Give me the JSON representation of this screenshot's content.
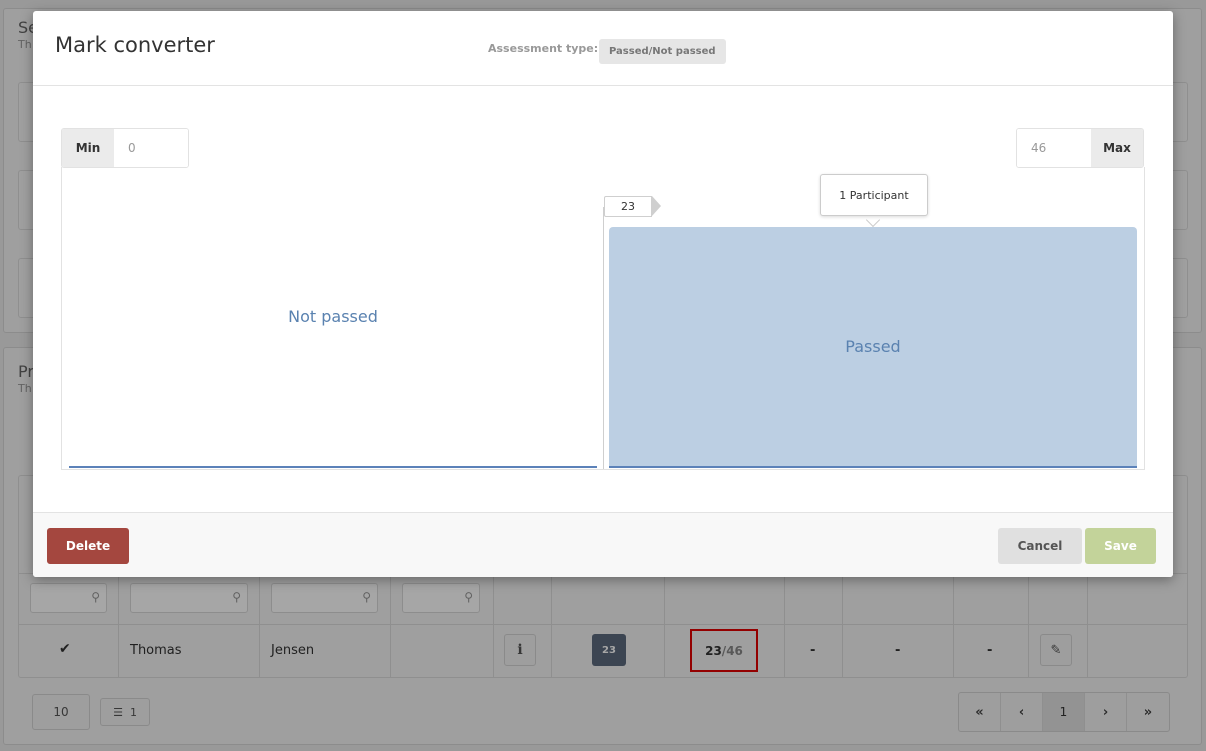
{
  "background": {
    "section1_heading": "Se",
    "section1_sub": "Th",
    "section2_heading": "Pr",
    "section2_sub": "Th",
    "row": {
      "check": "✔",
      "first_name": "Thomas",
      "last_name": "Jensen",
      "info": "i",
      "score_badge": "23",
      "score": "23",
      "score_sep": "/",
      "score_max": "46",
      "col_a": "-",
      "col_b": "-",
      "col_c": "-"
    },
    "page_size": "10",
    "list_count": "1",
    "pager": {
      "first": "«",
      "prev": "‹",
      "current": "1",
      "next": "›",
      "last": "»"
    }
  },
  "modal": {
    "title": "Mark converter",
    "assessment_label": "Assessment type:",
    "assessment_value": "Passed/Not passed",
    "min_label": "Min",
    "min_value": "0",
    "max_label": "Max",
    "max_value": "46",
    "threshold": "23",
    "tooltip": "1 Participant",
    "zone_not_passed": "Not passed",
    "zone_passed": "Passed",
    "delete_label": "Delete",
    "cancel_label": "Cancel",
    "save_label": "Save"
  }
}
